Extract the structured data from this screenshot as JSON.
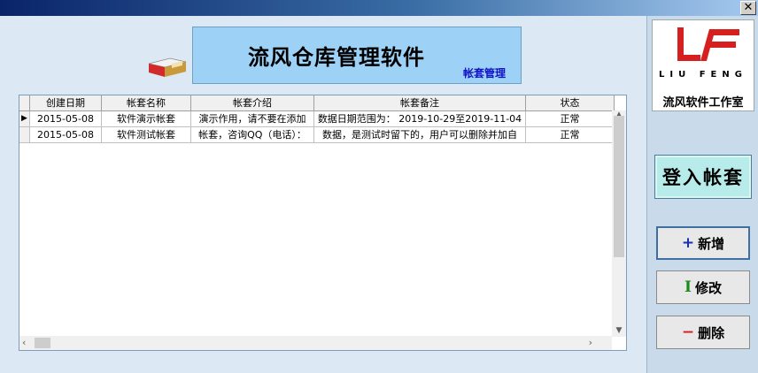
{
  "banner": {
    "title": "流风仓库管理软件",
    "subtitle": "帐套管理"
  },
  "table": {
    "columns": [
      "创建日期",
      "帐套名称",
      "帐套介绍",
      "帐套备注",
      "状态"
    ],
    "rows": [
      [
        "2015-05-08",
        "软件演示帐套",
        "演示作用，请不要在添加",
        "数据日期范围为： 2019-10-29至2019-11-04",
        "正常"
      ],
      [
        "2015-05-08",
        "软件测试帐套",
        "帐套，咨询QQ（电话）：",
        "数据，是测试时留下的，用户可以删除并加自",
        "正常"
      ]
    ],
    "current_row_marker": "▶"
  },
  "logo": {
    "name": "LIU FENG",
    "studio": "流风软件工作室"
  },
  "buttons": {
    "login": "登入帐套",
    "add": "新增",
    "edit": "修改",
    "delete": "删除"
  },
  "icons": {
    "add": "+",
    "edit": "I",
    "delete": "−",
    "close": "✕"
  },
  "colors": {
    "accent_red": "#d62020",
    "title_blue": "#1212c8",
    "banner_bg": "#9dd1f5"
  }
}
